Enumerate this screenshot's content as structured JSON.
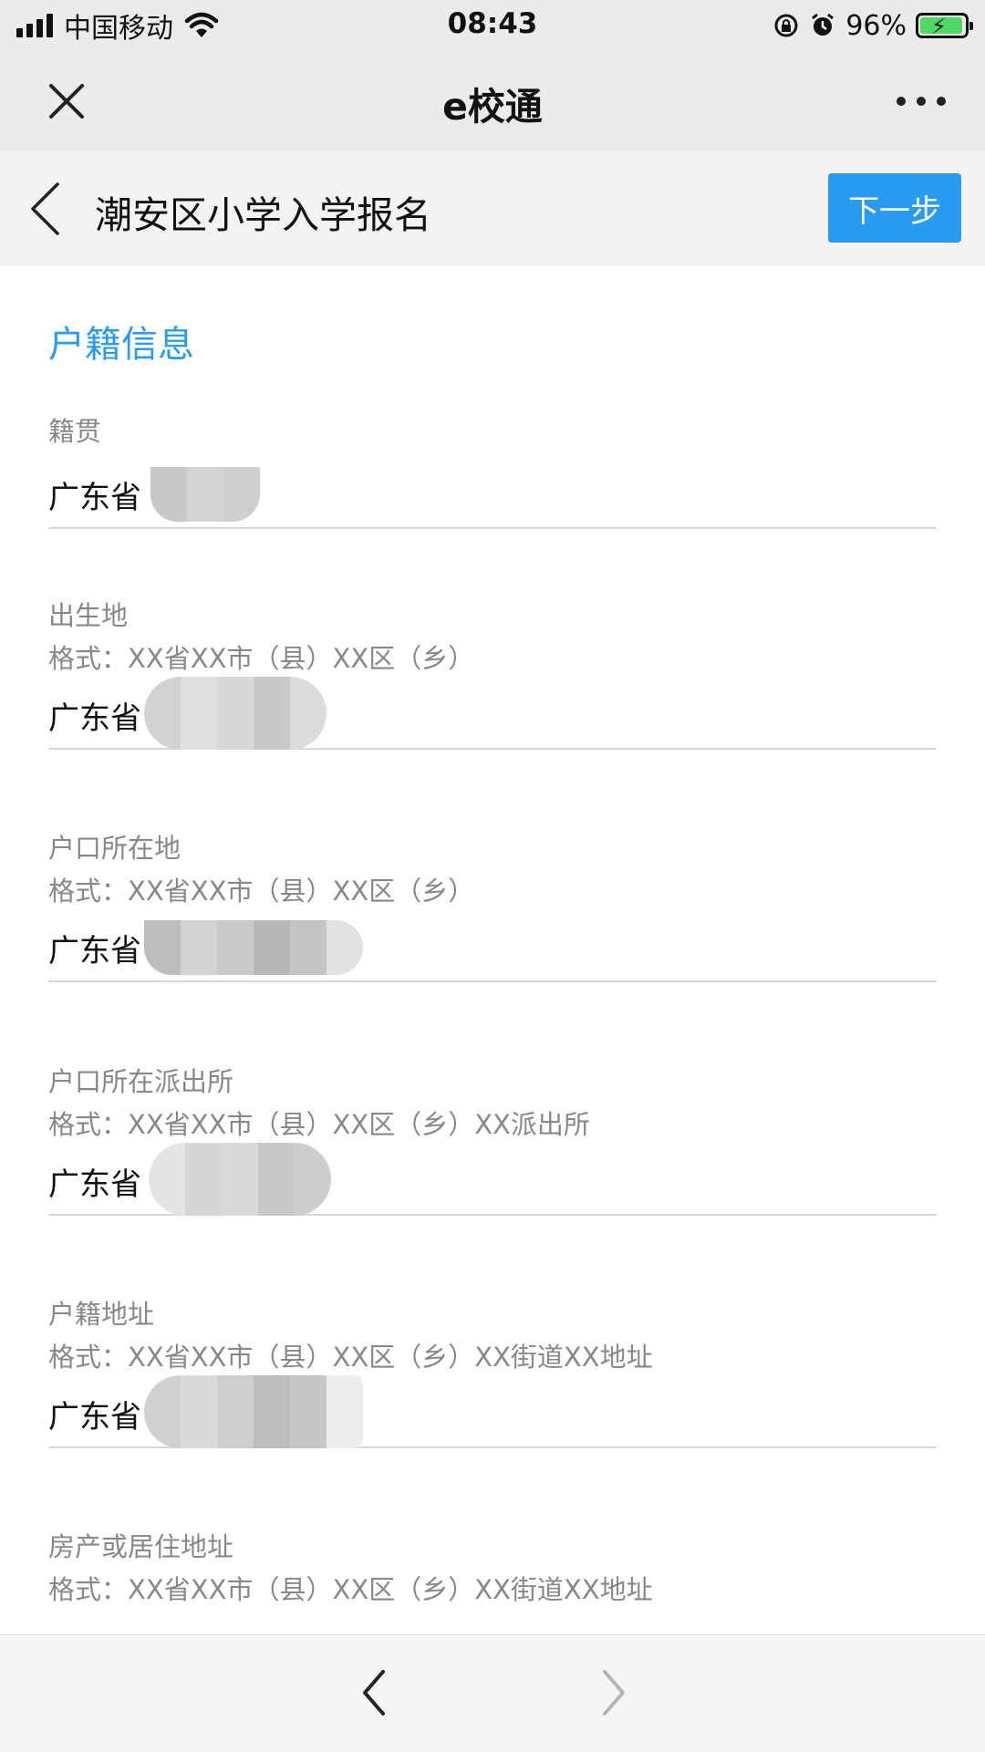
{
  "status_bar": {
    "carrier": "中国移动",
    "time": "08:43",
    "battery": "96%",
    "battery_level": 0.96
  },
  "wechat_bar": {
    "title": "e校通"
  },
  "page_header": {
    "title": "潮安区小学入学报名",
    "next_button": "下一步"
  },
  "section": {
    "title": "户籍信息"
  },
  "fields": [
    {
      "label": "籍贯",
      "hint": "",
      "value": "广东省"
    },
    {
      "label": "出生地",
      "hint": "格式：XX省XX市（县）XX区（乡）",
      "value": "广东省"
    },
    {
      "label": "户口所在地",
      "hint": "格式：XX省XX市（县）XX区（乡）",
      "value": "广东省"
    },
    {
      "label": "户口所在派出所",
      "hint": "格式：XX省XX市（县）XX区（乡）XX派出所",
      "value": "广东省"
    },
    {
      "label": "户籍地址",
      "hint": "格式：XX省XX市（县）XX区（乡）XX街道XX地址",
      "value": "广东省"
    },
    {
      "label": "房产或居住地址",
      "hint": "格式：XX省XX市（县）XX区（乡）XX街道XX地址",
      "value": ""
    }
  ],
  "icons": {
    "close": "close-icon",
    "more": "more-icon",
    "back": "chevron-left-icon",
    "nav_back": "nav-back-icon",
    "nav_forward": "nav-forward-icon"
  },
  "colors": {
    "accent": "#2a9bf2",
    "label": "#888888",
    "battery_fill": "#4cd964"
  }
}
